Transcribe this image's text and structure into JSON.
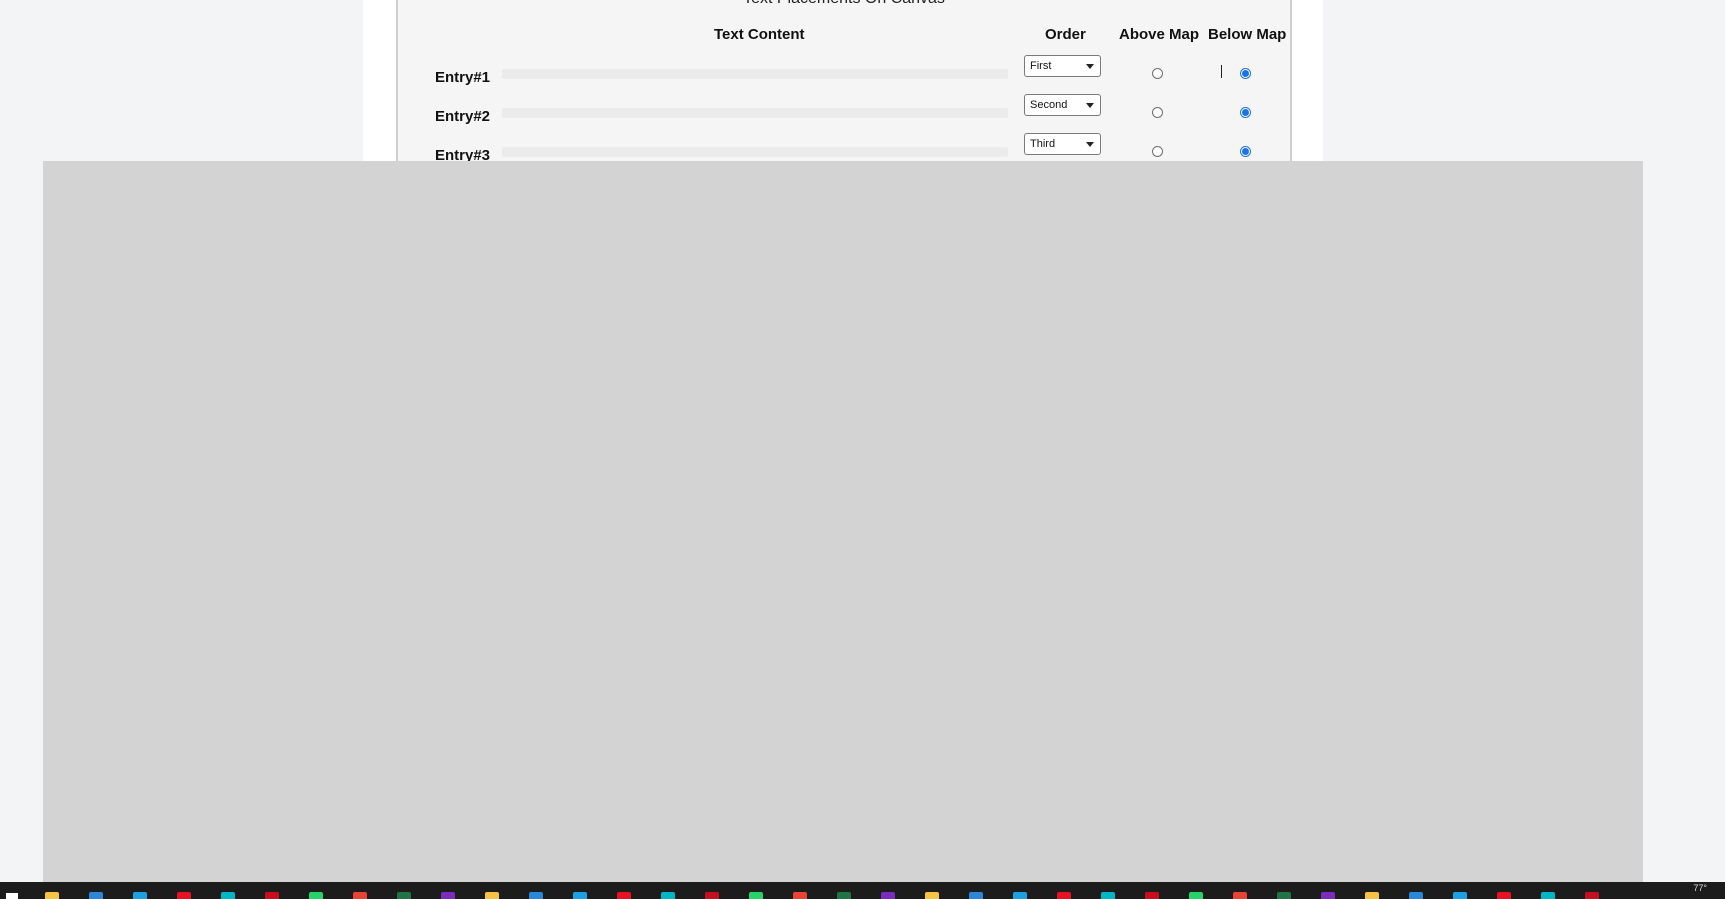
{
  "panel": {
    "title": "Text Placements On Canvas",
    "headers": {
      "text_content": "Text Content",
      "order": "Order",
      "above_map": "Above Map",
      "below_map": "Below Map"
    },
    "entries": [
      {
        "label": "Entry#1",
        "text_value": "",
        "order": "First",
        "above_map": false,
        "below_map": true
      },
      {
        "label": "Entry#2",
        "text_value": "",
        "order": "Second",
        "above_map": false,
        "below_map": true
      },
      {
        "label": "Entry#3",
        "text_value": "",
        "order": "Third",
        "above_map": false,
        "below_map": true
      }
    ]
  },
  "overlay": {
    "color": "#d3d3d3"
  },
  "taskbar": {
    "weather": "77°",
    "icons": [
      "start-icon",
      "file-explorer-icon",
      "app-icon",
      "edge-icon",
      "app-icon",
      "edge-icon",
      "app-icon",
      "app-icon",
      "app-icon",
      "app-icon",
      "app-icon",
      "whatsapp-icon",
      "app-icon",
      "app-icon",
      "app-icon",
      "app-icon",
      "app-icon",
      "chrome-icon",
      "app-icon",
      "excel-icon",
      "app-icon",
      "app-icon",
      "app-icon",
      "app-icon",
      "visual-studio-icon",
      "app-icon",
      "app-icon",
      "app-icon",
      "app-icon",
      "app-icon",
      "app-icon",
      "app-icon",
      "app-icon",
      "app-icon",
      "app-icon",
      "app-icon",
      "app-icon"
    ],
    "accent_colors": [
      "#f6c343",
      "#2b88d8",
      "#1ba1e2",
      "#e81123",
      "#00b7c3",
      "#c50f1f",
      "#25d366",
      "#ea4335",
      "#217346",
      "#7b2cbf"
    ]
  }
}
